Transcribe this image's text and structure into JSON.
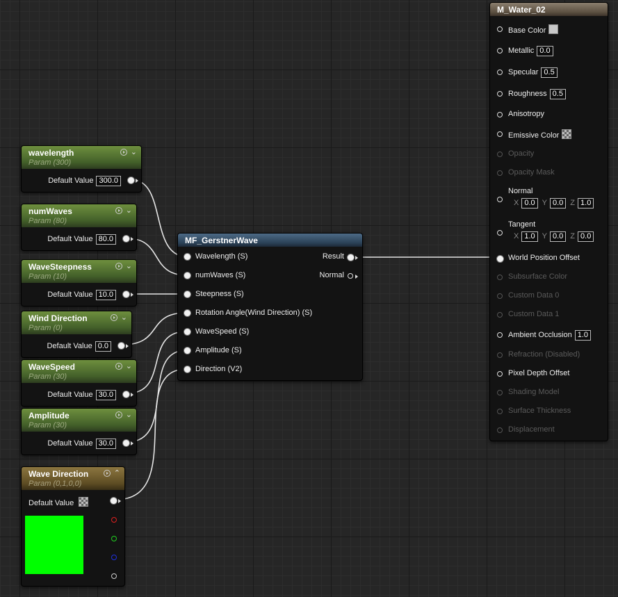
{
  "colors": {
    "background": "#262626",
    "param_header": "#5a7a34",
    "vector_header": "#7a6430",
    "function_header": "#3e5870",
    "material_header": "#7d7060",
    "wire": "#e8e8e8",
    "preview": "#00ff00"
  },
  "params": [
    {
      "title": "wavelength",
      "sub": "Param (300)",
      "label": "Default Value",
      "value": "300.0"
    },
    {
      "title": "numWaves",
      "sub": "Param (80)",
      "label": "Default Value",
      "value": "80.0"
    },
    {
      "title": "WaveSteepness",
      "sub": "Param (10)",
      "label": "Default Value",
      "value": "10.0"
    },
    {
      "title": "Wind Direction",
      "sub": "Param (0)",
      "label": "Default Value",
      "value": "0.0"
    },
    {
      "title": "WaveSpeed",
      "sub": "Param (30)",
      "label": "Default Value",
      "value": "30.0"
    },
    {
      "title": "Amplitude",
      "sub": "Param (30)",
      "label": "Default Value",
      "value": "30.0"
    }
  ],
  "vector_param": {
    "title": "Wave Direction",
    "sub": "Param (0,1,0,0)",
    "label": "Default Value",
    "preview_color": "#00ff00",
    "channel_pins": [
      "red",
      "green",
      "blue",
      "alpha"
    ]
  },
  "function_node": {
    "title": "MF_GerstnerWave",
    "inputs": [
      "Wavelength (S)",
      "numWaves (S)",
      "Steepness (S)",
      "Rotation Angle(Wind Direction) (S)",
      "WaveSpeed (S)",
      "Amplitude (S)",
      "Direction (V2)"
    ],
    "outputs": [
      "Result",
      "Normal"
    ]
  },
  "material_node": {
    "title": "M_Water_02",
    "pins": [
      {
        "label": "Base Color",
        "kind": "swatch",
        "enabled": true
      },
      {
        "label": "Metallic",
        "value": "0.0",
        "enabled": true
      },
      {
        "label": "Specular",
        "value": "0.5",
        "enabled": true
      },
      {
        "label": "Roughness",
        "value": "0.5",
        "enabled": true
      },
      {
        "label": "Anisotropy",
        "enabled": true
      },
      {
        "label": "Emissive Color",
        "kind": "checker",
        "enabled": true
      },
      {
        "label": "Opacity",
        "enabled": false
      },
      {
        "label": "Opacity Mask",
        "enabled": false
      },
      {
        "label": "Normal",
        "xyz": [
          "0.0",
          "0.0",
          "1.0"
        ],
        "enabled": true
      },
      {
        "label": "Tangent",
        "xyz": [
          "1.0",
          "0.0",
          "0.0"
        ],
        "enabled": true
      },
      {
        "label": "World Position Offset",
        "enabled": true,
        "connected": true
      },
      {
        "label": "Subsurface Color",
        "enabled": false
      },
      {
        "label": "Custom Data 0",
        "enabled": false
      },
      {
        "label": "Custom Data 1",
        "enabled": false
      },
      {
        "label": "Ambient Occlusion",
        "value": "1.0",
        "enabled": true
      },
      {
        "label": "Refraction (Disabled)",
        "enabled": false
      },
      {
        "label": "Pixel Depth Offset",
        "enabled": true
      },
      {
        "label": "Shading Model",
        "enabled": false
      },
      {
        "label": "Surface Thickness",
        "enabled": false
      },
      {
        "label": "Displacement",
        "enabled": false
      }
    ],
    "axis_labels": [
      "X",
      "Y",
      "Z"
    ]
  }
}
